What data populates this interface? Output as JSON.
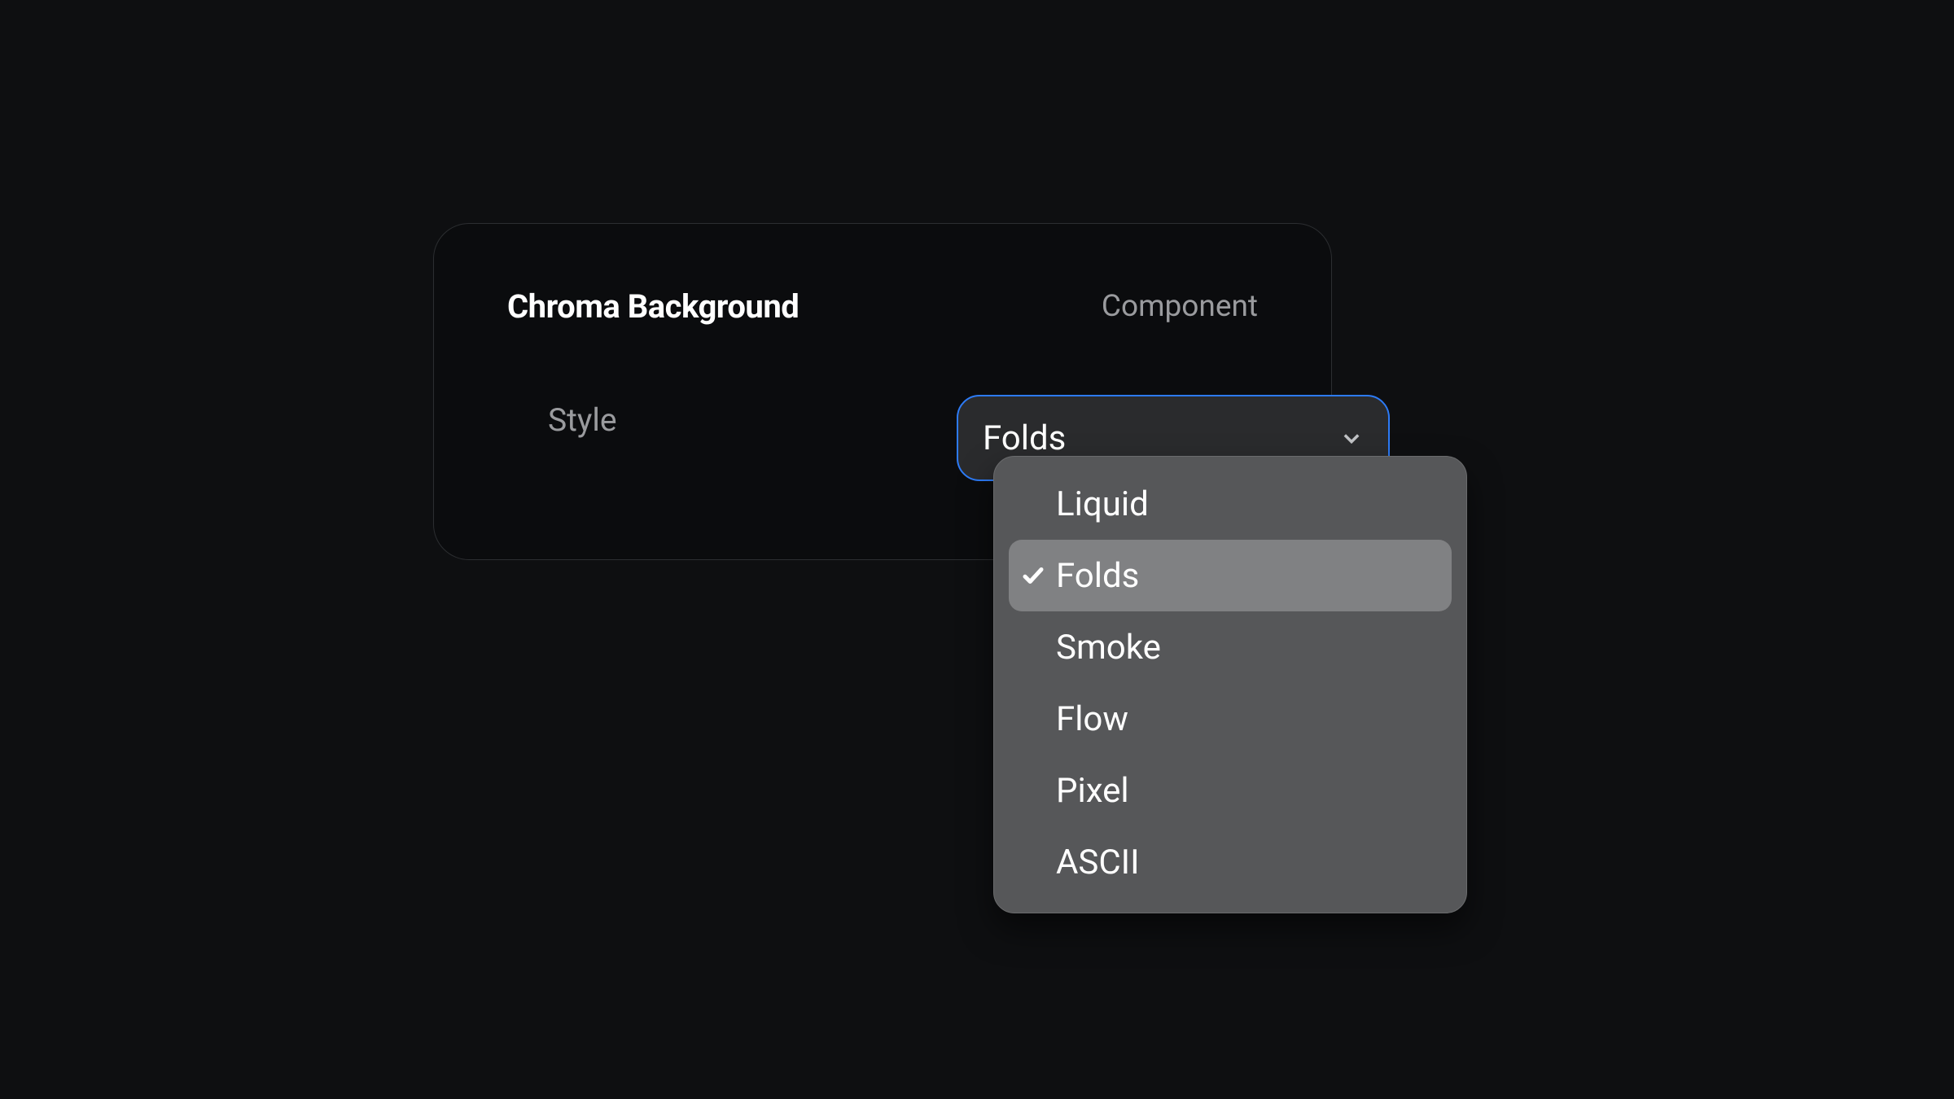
{
  "panel": {
    "title": "Chroma Background",
    "tag": "Component"
  },
  "style_row": {
    "label": "Style",
    "selected_value": "Folds"
  },
  "dropdown": {
    "options": [
      {
        "label": "Liquid",
        "selected": false
      },
      {
        "label": "Folds",
        "selected": true
      },
      {
        "label": "Smoke",
        "selected": false
      },
      {
        "label": "Flow",
        "selected": false
      },
      {
        "label": "Pixel",
        "selected": false
      },
      {
        "label": "ASCII",
        "selected": false
      }
    ]
  },
  "colors": {
    "accent": "#2d7bf6",
    "panel_bg": "#0b0c0e",
    "page_bg": "#0e0f11",
    "dropdown_bg": "#565759",
    "dropdown_selected_bg": "#808183"
  }
}
